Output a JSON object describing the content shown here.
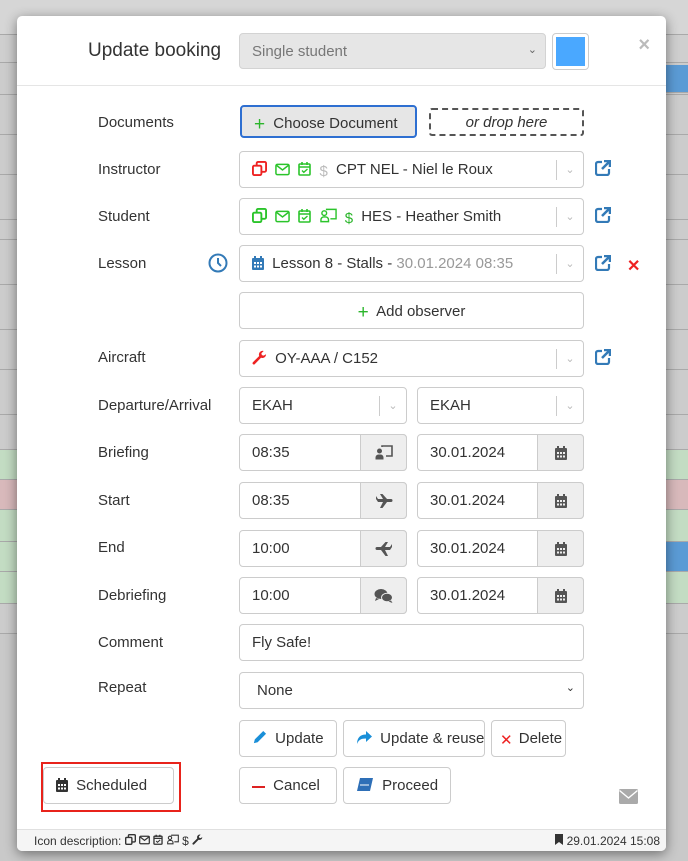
{
  "background": {
    "accent_blue": "#5b9bd5",
    "green": "#c3dcc3",
    "red": "#d8b9bb"
  },
  "header": {
    "title": "Update booking",
    "booking_type": "Single student",
    "color_swatch": "#4aa8ff",
    "close_label": "×"
  },
  "form": {
    "documents": {
      "label": "Documents",
      "choose_label": "Choose Document",
      "drop_label": "or drop here"
    },
    "instructor": {
      "label": "Instructor",
      "value": "CPT NEL - Niel le Roux",
      "status_icons": [
        "copy-icon-red",
        "envelope-icon-green",
        "calendar-check-icon-green",
        "dollar-icon-grey"
      ]
    },
    "student": {
      "label": "Student",
      "value": "HES - Heather Smith",
      "status_icons": [
        "copy-icon-green",
        "envelope-icon-green",
        "calendar-check-icon-green",
        "briefing-icon-green",
        "dollar-icon-green"
      ]
    },
    "lesson": {
      "label": "Lesson",
      "value": "Lesson 8 - Stalls - ",
      "date": "30.01.2024 08:35"
    },
    "add_observer": "Add observer",
    "aircraft": {
      "label": "Aircraft",
      "value": "OY-AAA / C152"
    },
    "departure_arrival": {
      "label": "Departure/Arrival",
      "departure": "EKAH",
      "arrival": "EKAH"
    },
    "briefing": {
      "label": "Briefing",
      "time": "08:35",
      "date": "30.01.2024"
    },
    "start": {
      "label": "Start",
      "time": "08:35",
      "date": "30.01.2024"
    },
    "end": {
      "label": "End",
      "time": "10:00",
      "date": "30.01.2024"
    },
    "debriefing": {
      "label": "Debriefing",
      "time": "10:00",
      "date": "30.01.2024"
    },
    "comment": {
      "label": "Comment",
      "value": "Fly Safe!"
    },
    "repeat": {
      "label": "Repeat",
      "value": "None"
    }
  },
  "actions": {
    "update": "Update",
    "update_reuse": "Update & reuse",
    "delete": "Delete",
    "cancel": "Cancel",
    "proceed": "Proceed",
    "status": "Scheduled"
  },
  "footer": {
    "icon_description_label": "Icon description:",
    "timestamp": "29.01.2024 15:08"
  }
}
